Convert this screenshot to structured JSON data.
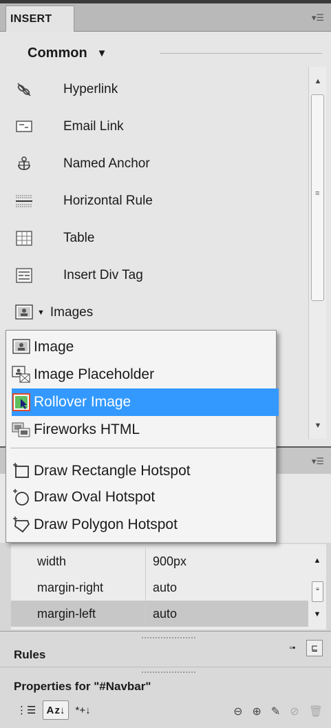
{
  "panel": {
    "tab_title": "INSERT",
    "category": "Common",
    "category_arrow": "▼",
    "items": [
      {
        "label": "Hyperlink",
        "icon": "hyperlink-icon"
      },
      {
        "label": "Email Link",
        "icon": "email-link-icon"
      },
      {
        "label": "Named Anchor",
        "icon": "named-anchor-icon"
      },
      {
        "label": "Horizontal Rule",
        "icon": "horizontal-rule-icon"
      },
      {
        "label": "Table",
        "icon": "table-icon"
      },
      {
        "label": "Insert Div Tag",
        "icon": "div-tag-icon"
      },
      {
        "label": "Images",
        "icon": "image-icon"
      }
    ]
  },
  "dropdown": {
    "items": [
      {
        "label": "Image",
        "icon": "image-icon",
        "selected": false
      },
      {
        "label": "Image Placeholder",
        "icon": "image-placeholder-icon",
        "selected": false
      },
      {
        "label": "Rollover Image",
        "icon": "rollover-image-icon",
        "selected": true
      },
      {
        "label": "Fireworks HTML",
        "icon": "fireworks-html-icon",
        "selected": false
      },
      {
        "label": "Draw Rectangle Hotspot",
        "icon": "rectangle-hotspot-icon",
        "selected": false
      },
      {
        "label": "Draw Oval Hotspot",
        "icon": "oval-hotspot-icon",
        "selected": false
      },
      {
        "label": "Draw Polygon Hotspot",
        "icon": "polygon-hotspot-icon",
        "selected": false
      }
    ],
    "selected_color": "#3399ff"
  },
  "properties": {
    "rows": [
      {
        "name": "width",
        "value": "900px"
      },
      {
        "name": "margin-right",
        "value": "auto"
      },
      {
        "name": "margin-left",
        "value": "auto"
      }
    ]
  },
  "rules": {
    "label": "Rules"
  },
  "props_for": {
    "label": "Properties for \"#Navbar\"",
    "sort_label": "A z↓",
    "set_props_label": "*+↓"
  },
  "colors": {
    "panel_bg": "#e6e6e6",
    "highlight": "#3399ff"
  }
}
